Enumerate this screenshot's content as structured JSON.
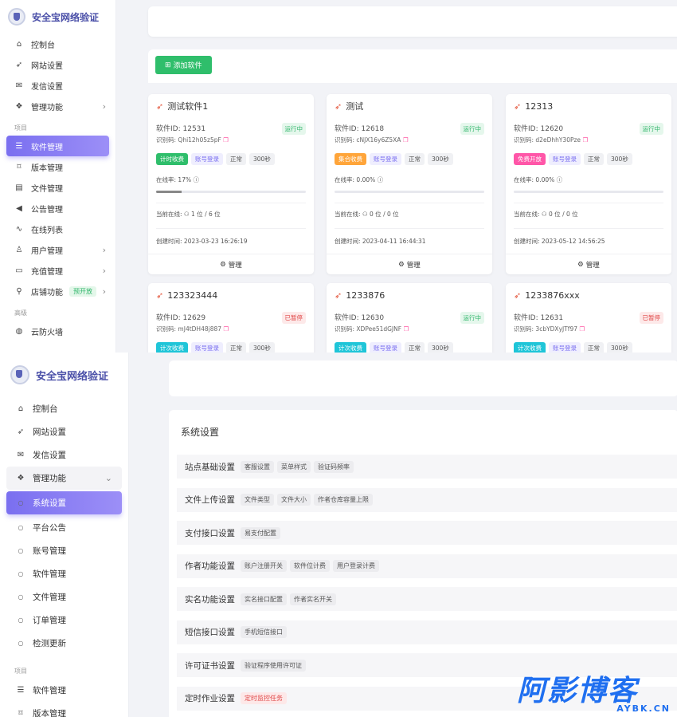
{
  "brand": {
    "title": "安全宝网络验证"
  },
  "top": {
    "nav": [
      {
        "label": "控制台",
        "icon": "home-icon"
      },
      {
        "label": "网站设置",
        "icon": "rocket-icon"
      },
      {
        "label": "发信设置",
        "icon": "mail-icon"
      },
      {
        "label": "管理功能",
        "icon": "apps-icon",
        "arrow": "›"
      }
    ],
    "section_project": "项目",
    "project_nav": [
      {
        "label": "软件管理",
        "icon": "list-icon",
        "active": true
      },
      {
        "label": "版本管理",
        "icon": "bookmark-icon"
      },
      {
        "label": "文件管理",
        "icon": "file-icon"
      },
      {
        "label": "公告管理",
        "icon": "megaphone-icon"
      },
      {
        "label": "在线列表",
        "icon": "pulse-icon"
      },
      {
        "label": "用户管理",
        "icon": "user-icon",
        "arrow": "›"
      },
      {
        "label": "充值管理",
        "icon": "card-icon",
        "arrow": "›"
      },
      {
        "label": "店铺功能",
        "icon": "pin-icon",
        "arrow": "›",
        "tag": "预开放"
      }
    ],
    "section_advanced": "高级",
    "advanced_nav": [
      {
        "label": "云防火墙",
        "icon": "globe-icon"
      }
    ],
    "add_button": "添加软件",
    "cards": [
      {
        "title": "测试软件1",
        "id_label": "软件ID:",
        "id": "12531",
        "code_label": "识别码:",
        "code": "Qhi12h05z5pF",
        "status": "运行中",
        "status_type": "run",
        "mode": "计时收费",
        "mode_color": "green",
        "login": "账号登录",
        "state": "正常",
        "interval": "300秒",
        "rate_label": "在线率:",
        "rate": "17%",
        "rate_value": 0.17,
        "online_label": "当前在线:",
        "online": "1 位 / 6 位",
        "created_label": "创建时间:",
        "created": "2023-03-23 16:26:19",
        "manage": "管理"
      },
      {
        "title": "测试",
        "id_label": "软件ID:",
        "id": "12618",
        "code_label": "识别码:",
        "code": "cNJX16y6Z5XA",
        "status": "运行中",
        "status_type": "run",
        "mode": "集合收费",
        "mode_color": "orange",
        "login": "账号登录",
        "state": "正常",
        "interval": "300秒",
        "rate_label": "在线率:",
        "rate": "0.00%",
        "rate_value": 0,
        "online_label": "当前在线:",
        "online": "0 位 / 0 位",
        "created_label": "创建时间:",
        "created": "2023-04-11 16:44:31",
        "manage": "管理"
      },
      {
        "title": "12313",
        "id_label": "软件ID:",
        "id": "12620",
        "code_label": "识别码:",
        "code": "d2eDhhY30Pze",
        "status": "运行中",
        "status_type": "run",
        "mode": "免费开放",
        "mode_color": "pink",
        "login": "账号登录",
        "state": "正常",
        "interval": "300秒",
        "rate_label": "在线率:",
        "rate": "0.00%",
        "rate_value": 0,
        "online_label": "当前在线:",
        "online": "0 位 / 0 位",
        "created_label": "创建时间:",
        "created": "2023-05-12 14:56:25",
        "manage": "管理"
      },
      {
        "title": "123323444",
        "id_label": "软件ID:",
        "id": "12629",
        "code_label": "识别码:",
        "code": "mJ4tDH48j887",
        "status": "已暂停",
        "status_type": "stop",
        "mode": "计次收费",
        "mode_color": "cyan",
        "login": "账号登录",
        "state": "正常",
        "interval": "300秒"
      },
      {
        "title": "1233876",
        "id_label": "软件ID:",
        "id": "12630",
        "code_label": "识别码:",
        "code": "XDPee51dGJNF",
        "status": "运行中",
        "status_type": "run",
        "mode": "计次收费",
        "mode_color": "cyan",
        "login": "账号登录",
        "state": "正常",
        "interval": "300秒"
      },
      {
        "title": "1233876xxx",
        "id_label": "软件ID:",
        "id": "12631",
        "code_label": "识别码:",
        "code": "3cbYDXyJTf97",
        "status": "已暂停",
        "status_type": "stop",
        "mode": "计次收费",
        "mode_color": "cyan",
        "login": "账号登录",
        "state": "正常",
        "interval": "300秒"
      }
    ]
  },
  "bottom": {
    "nav": [
      {
        "label": "控制台",
        "icon": "home-icon"
      },
      {
        "label": "网站设置",
        "icon": "rocket-icon"
      },
      {
        "label": "发信设置",
        "icon": "mail-icon"
      },
      {
        "label": "管理功能",
        "icon": "apps-icon",
        "arrow": "⌄",
        "open": true
      }
    ],
    "sub_nav": [
      {
        "label": "系统设置",
        "active": true
      },
      {
        "label": "平台公告"
      },
      {
        "label": "账号管理"
      },
      {
        "label": "软件管理"
      },
      {
        "label": "文件管理"
      },
      {
        "label": "订单管理"
      },
      {
        "label": "检测更新"
      }
    ],
    "section_project": "项目",
    "project_nav": [
      {
        "label": "软件管理",
        "icon": "list-icon"
      },
      {
        "label": "版本管理",
        "icon": "bookmark-icon"
      }
    ],
    "panel_title": "系统设置",
    "settings": [
      {
        "label": "站点基础设置",
        "chips": [
          "客服设置",
          "菜单样式",
          "验证码频率"
        ]
      },
      {
        "label": "文件上传设置",
        "chips": [
          "文件类型",
          "文件大小",
          "作者仓库容量上限"
        ]
      },
      {
        "label": "支付接口设置",
        "chips": [
          "易支付配置"
        ]
      },
      {
        "label": "作者功能设置",
        "chips": [
          "账户注册开关",
          "软件位计费",
          "用户登录计费"
        ]
      },
      {
        "label": "实名功能设置",
        "chips": [
          "实名接口配置",
          "作者实名开关"
        ]
      },
      {
        "label": "短信接口设置",
        "chips": [
          "手机短信接口"
        ]
      },
      {
        "label": "许可证书设置",
        "chips": [
          "验证程序使用许可证"
        ]
      },
      {
        "label": "定时作业设置",
        "chips": [
          "定时监控任务"
        ],
        "chip_red": true
      }
    ]
  },
  "watermark": {
    "main": "阿影博客",
    "sub": "AYBK.CN"
  },
  "colors": {
    "accent": "#7a6ff0",
    "success": "#2fbe6b",
    "danger": "#e04848",
    "watermark": "#1f6ff0"
  }
}
